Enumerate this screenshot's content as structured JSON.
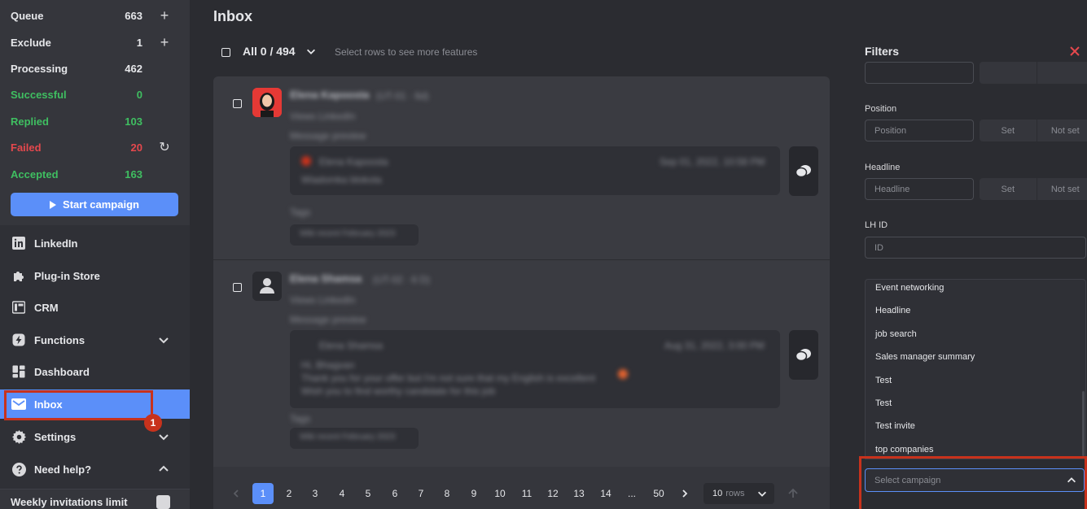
{
  "sidebar": {
    "stats": [
      {
        "label": "Queue",
        "value": "663",
        "color": "#e6e7ea",
        "action": "+"
      },
      {
        "label": "Exclude",
        "value": "1",
        "color": "#e6e7ea",
        "action": "+"
      },
      {
        "label": "Processing",
        "value": "462",
        "color": "#e6e7ea",
        "action": ""
      },
      {
        "label": "Successful",
        "value": "0",
        "color": "#3fbf61",
        "action": ""
      },
      {
        "label": "Replied",
        "value": "103",
        "color": "#3fbf61",
        "action": ""
      },
      {
        "label": "Failed",
        "value": "20",
        "color": "#e5484d",
        "action": "↻"
      },
      {
        "label": "Accepted",
        "value": "163",
        "color": "#3fbf61",
        "action": ""
      }
    ],
    "start_campaign_label": "Start campaign",
    "nav": [
      {
        "label": "LinkedIn",
        "icon": "linkedin-icon"
      },
      {
        "label": "Plug-in Store",
        "icon": "puzzle-icon"
      },
      {
        "label": "CRM",
        "icon": "crm-icon"
      },
      {
        "label": "Functions",
        "icon": "bolt-icon"
      },
      {
        "label": "Dashboard",
        "icon": "dashboard-icon"
      },
      {
        "label": "Inbox",
        "icon": "mail-icon"
      },
      {
        "label": "Settings",
        "icon": "gear-icon"
      },
      {
        "label": "Need help?",
        "icon": "help-icon"
      }
    ],
    "badge": "1",
    "weekly_label": "Weekly invitations limit"
  },
  "main": {
    "title": "Inbox",
    "all_count": "All 0 / 494",
    "hint": "Select rows to see more features",
    "messages": [
      {
        "name": "Elena Kapoosta",
        "time": "(UT-01 · 6d)",
        "subtitle": "Views LinkedIn",
        "section": "Message preview",
        "bubble_author": "Elena Kapoosta",
        "bubble_date": "Sep 01, 2022, 10:58 PM",
        "bubble_text": "Wiadomka blokota",
        "tags_label": "Tags",
        "tag": "Wiki recent February 2023"
      },
      {
        "name": "Elena Shamsa",
        "time": "(UT-02 · 6 D)",
        "subtitle": "Views LinkedIn",
        "section": "Message preview",
        "bubble_author": "Elena Shamsa",
        "bubble_date": "Aug 31, 2022, 3:00 PM",
        "bubble_text": "Hi, Bhagvan",
        "bubble_text2": "Thank you for your offer but I'm not sure that my English is excellent",
        "bubble_text3": "Wish you to find worthy candidate for this job",
        "tags_label": "Tags",
        "tag": "Wiki recent February 2023"
      }
    ],
    "pagination": {
      "pages": [
        "1",
        "2",
        "3",
        "4",
        "5",
        "6",
        "7",
        "8",
        "9",
        "10",
        "11",
        "12",
        "13",
        "14",
        "...",
        "50"
      ],
      "active": "1",
      "rows_value": "10",
      "rows_label": "rows"
    }
  },
  "filters": {
    "title": "Filters",
    "position_label": "Position",
    "position_placeholder": "Position",
    "headline_label": "Headline",
    "headline_placeholder": "Headline",
    "lhid_label": "LH ID",
    "lhid_placeholder": "ID",
    "set_label": "Set",
    "notset_label": "Not set",
    "campaigns": [
      "Event networking",
      "Headline",
      "job search",
      "Sales manager summary",
      "Test",
      "Test",
      "Test invite",
      "top companies"
    ],
    "select_campaign_placeholder": "Select campaign"
  },
  "colors": {
    "accent": "#5b8ff9",
    "highlight": "#c8321c",
    "green": "#3fbf61",
    "red": "#e5484d"
  }
}
